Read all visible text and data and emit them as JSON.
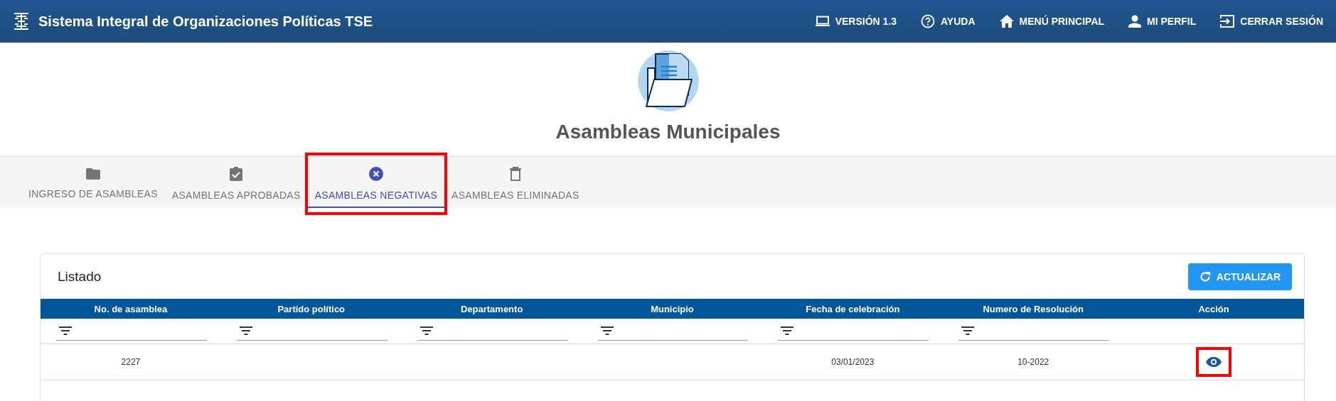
{
  "header": {
    "title": "Sistema Integral de Organizaciones Políticas TSE",
    "nav": [
      {
        "kind": "laptop",
        "label": "VERSIÓN 1.3"
      },
      {
        "kind": "help",
        "label": "AYUDA"
      },
      {
        "kind": "home",
        "label": "MENÚ PRINCIPAL"
      },
      {
        "kind": "person",
        "label": "MI PERFIL"
      },
      {
        "kind": "logout",
        "label": "CERRAR SESIÓN"
      }
    ]
  },
  "page": {
    "title": "Asambleas Municipales"
  },
  "tabs": [
    {
      "kind": "folder",
      "label": "INGRESO DE ASAMBLEAS",
      "selected": false,
      "highlighted": false
    },
    {
      "kind": "clipboard",
      "label": "ASAMBLEAS APROBADAS",
      "selected": false,
      "highlighted": false
    },
    {
      "kind": "cancel",
      "label": "ASAMBLEAS NEGATIVAS",
      "selected": true,
      "highlighted": true
    },
    {
      "kind": "trash",
      "label": "ASAMBLEAS ELIMINADAS",
      "selected": false,
      "highlighted": false
    }
  ],
  "listing": {
    "title": "Listado",
    "refresh_button": "ACTUALIZAR",
    "columns": [
      {
        "label": "No. de asamblea",
        "filter": true
      },
      {
        "label": "Partido político",
        "filter": true
      },
      {
        "label": "Departamento",
        "filter": true
      },
      {
        "label": "Municipio",
        "filter": true
      },
      {
        "label": "Fecha de celebración",
        "filter": true
      },
      {
        "label": "Numero de Resolución",
        "filter": true
      },
      {
        "label": "Acción",
        "filter": false
      }
    ],
    "rows": [
      {
        "cells": [
          "2227",
          "",
          "",
          "",
          "03/01/2023",
          "10-2022"
        ],
        "action_highlighted": true
      }
    ]
  }
}
